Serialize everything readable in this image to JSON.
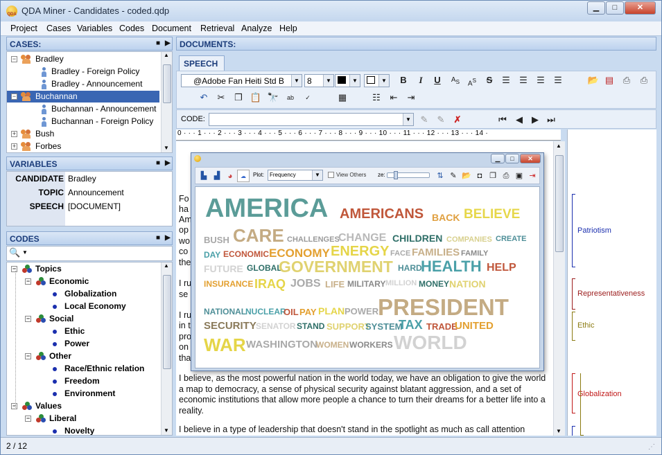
{
  "window": {
    "title": "QDA Miner - Candidates - coded.qdp",
    "app_icon_text": "QDA"
  },
  "menu": [
    "Project",
    "Cases",
    "Variables",
    "Codes",
    "Document",
    "Retrieval",
    "Analyze",
    "Help"
  ],
  "cases": {
    "header": "CASES:",
    "items": [
      {
        "label": "Bradley",
        "level": 0,
        "kind": "group",
        "exp": "−"
      },
      {
        "label": "Bradley - Foreign Policy",
        "level": 1,
        "kind": "person"
      },
      {
        "label": "Bradley - Announcement",
        "level": 1,
        "kind": "person"
      },
      {
        "label": "Buchannan",
        "level": 0,
        "kind": "group",
        "exp": "−",
        "selected": true
      },
      {
        "label": "Buchannan - Announcement",
        "level": 1,
        "kind": "person"
      },
      {
        "label": "Buchannan - Foreign Policy",
        "level": 1,
        "kind": "person"
      },
      {
        "label": "Bush",
        "level": 0,
        "kind": "group",
        "exp": "+"
      },
      {
        "label": "Forbes",
        "level": 0,
        "kind": "group",
        "exp": "+"
      }
    ]
  },
  "variables": {
    "header": "VARIABLES",
    "rows": [
      {
        "name": "CANDIDATE",
        "value": "Bradley"
      },
      {
        "name": "TOPIC",
        "value": "Announcement"
      },
      {
        "name": "SPEECH",
        "value": "[DOCUMENT]"
      }
    ]
  },
  "codes": {
    "header": "CODES",
    "items": [
      {
        "label": "Topics",
        "level": 0,
        "kind": "category",
        "exp": "−"
      },
      {
        "label": "Economic",
        "level": 1,
        "kind": "category",
        "exp": "−"
      },
      {
        "label": "Globalization",
        "level": 2,
        "kind": "code"
      },
      {
        "label": "Local Economy",
        "level": 2,
        "kind": "code"
      },
      {
        "label": "Social",
        "level": 1,
        "kind": "category",
        "exp": "−"
      },
      {
        "label": "Ethic",
        "level": 2,
        "kind": "code"
      },
      {
        "label": "Power",
        "level": 2,
        "kind": "code"
      },
      {
        "label": "Other",
        "level": 1,
        "kind": "category",
        "exp": "−"
      },
      {
        "label": "Race/Ethnic relation",
        "level": 2,
        "kind": "code"
      },
      {
        "label": "Freedom",
        "level": 2,
        "kind": "code"
      },
      {
        "label": "Environment",
        "level": 2,
        "kind": "code"
      },
      {
        "label": "Values",
        "level": 0,
        "kind": "category",
        "exp": "−"
      },
      {
        "label": "Liberal",
        "level": 1,
        "kind": "category",
        "exp": "−"
      },
      {
        "label": "Novelty",
        "level": 2,
        "kind": "code"
      }
    ]
  },
  "documents": {
    "header": "DOCUMENTS:",
    "tab": "SPEECH",
    "font_name": "@Adobe Fan Heiti Std B",
    "font_size": "8",
    "code_label": "CODE:",
    "code_value": "",
    "ruler": "0 · · · 1 · · · 2 · · · 3 · · · 4 · · · 5 · · · 6 · · · 7 · · · 8 · · · 9 · · · 10 · · · 11 · · · 12 · · · 13 · · · 14 ·",
    "left_fragments": [
      "Fo",
      "ha",
      "Am",
      "op",
      "wo",
      "co",
      "the",
      "I ru",
      "se",
      "I ru",
      "in t",
      "pro",
      "on",
      "tha"
    ],
    "para1": "I believe, as the most powerful nation in the world today, we have an obligation to give the world a map to democracy, a sense of physical security against blatant aggression, and a set of economic institutions that allow more people a chance to turn their dreams for a better life into a reality.",
    "para2": "I believe in a type of leadership that doesn't stand in the spotlight as much as call attention"
  },
  "margin_codes": [
    {
      "label": "Patriotism",
      "color": "#1b2fae"
    },
    {
      "label": "Representativeness",
      "color": "#9b1c1c"
    },
    {
      "label": "Ethic",
      "color": "#8a7a10"
    },
    {
      "label": "Globalization",
      "color": "#c01818"
    }
  ],
  "wordcloud": {
    "plot_label": "Plot:",
    "plot_value": "Frequency",
    "view_others": "View Others",
    "size_label": "ze:",
    "words": [
      {
        "t": "AMERICA",
        "c": "#5b9c98"
      },
      {
        "t": "AMERICANS",
        "c": "#c0573a"
      },
      {
        "t": "BACK",
        "c": "#e0a040"
      },
      {
        "t": "BELIEVE",
        "c": "#e6d74a"
      },
      {
        "t": "BUSH",
        "c": "#a8a8a8"
      },
      {
        "t": "CARE",
        "c": "#c4ab83"
      },
      {
        "t": "CHALLENGES",
        "c": "#9a9a9a"
      },
      {
        "t": "CHANGE",
        "c": "#b9b9b9"
      },
      {
        "t": "CHILDREN",
        "c": "#2f6f68"
      },
      {
        "t": "COMPANIES",
        "c": "#d8d08e"
      },
      {
        "t": "CREATE",
        "c": "#4f8f98"
      },
      {
        "t": "DAY",
        "c": "#4aa0a8"
      },
      {
        "t": "ECONOMIC",
        "c": "#c0563a"
      },
      {
        "t": "ECONOMY",
        "c": "#e3a030"
      },
      {
        "t": "ENERGY",
        "c": "#e5d548"
      },
      {
        "t": "FACE",
        "c": "#a9a9a9"
      },
      {
        "t": "FAMILIES",
        "c": "#c8b08a"
      },
      {
        "t": "FAMILY",
        "c": "#8a8a8a"
      },
      {
        "t": "FUTURE",
        "c": "#d2d2d2"
      },
      {
        "t": "GLOBAL",
        "c": "#2f6f68"
      },
      {
        "t": "GOVERNMENT",
        "c": "#e0d270"
      },
      {
        "t": "HARD",
        "c": "#4f8f98"
      },
      {
        "t": "HEALTH",
        "c": "#4aa0a8"
      },
      {
        "t": "HELP",
        "c": "#c0563a"
      },
      {
        "t": "INSURANCE",
        "c": "#e3a030"
      },
      {
        "t": "IRAQ",
        "c": "#e5d548"
      },
      {
        "t": "JOBS",
        "c": "#a9a9a9"
      },
      {
        "t": "LIFE",
        "c": "#c8b08a"
      },
      {
        "t": "MILITARY",
        "c": "#8a8a8a"
      },
      {
        "t": "MILLION",
        "c": "#d2d2d2"
      },
      {
        "t": "MONEY",
        "c": "#2f6f68"
      },
      {
        "t": "NATION",
        "c": "#e0d270"
      },
      {
        "t": "PRESIDENT",
        "c": "#c4ab83"
      },
      {
        "t": "NATIONAL",
        "c": "#4f8f98"
      },
      {
        "t": "NUCLEAR",
        "c": "#4aa0a8"
      },
      {
        "t": "OIL",
        "c": "#c0563a"
      },
      {
        "t": "PAY",
        "c": "#e3a030"
      },
      {
        "t": "PLAN",
        "c": "#e5d548"
      },
      {
        "t": "POWER",
        "c": "#a9a9a9"
      },
      {
        "t": "SECURITY",
        "c": "#8a7a5a"
      },
      {
        "t": "SENATOR",
        "c": "#d2d2d2"
      },
      {
        "t": "STAND",
        "c": "#2f6f68"
      },
      {
        "t": "SUPPORT",
        "c": "#e0d270"
      },
      {
        "t": "SYSTEM",
        "c": "#4f8f98"
      },
      {
        "t": "TAX",
        "c": "#4aa0a8"
      },
      {
        "t": "TRADE",
        "c": "#c0563a"
      },
      {
        "t": "UNITED",
        "c": "#e3a030"
      },
      {
        "t": "WAR",
        "c": "#e5d548"
      },
      {
        "t": "WASHINGTON",
        "c": "#a9a9a9"
      },
      {
        "t": "WOMEN",
        "c": "#c8b08a"
      },
      {
        "t": "WORKERS",
        "c": "#8a8a8a"
      },
      {
        "t": "WORLD",
        "c": "#d2d2d2"
      }
    ]
  },
  "status": {
    "page": "2 / 12"
  }
}
